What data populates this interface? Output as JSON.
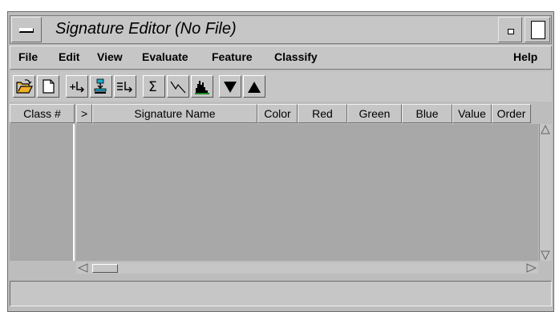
{
  "window": {
    "title": "Signature Editor (No File)"
  },
  "menubar": {
    "items": [
      {
        "label": "File"
      },
      {
        "label": "Edit"
      },
      {
        "label": "View"
      },
      {
        "label": "Evaluate"
      },
      {
        "label": "Feature"
      },
      {
        "label": "Classify"
      },
      {
        "label": "Help"
      }
    ]
  },
  "toolbar": {
    "buttons": [
      {
        "icon": "open-folder-icon"
      },
      {
        "icon": "new-file-icon"
      },
      {
        "icon": "add-signature-icon"
      },
      {
        "icon": "replace-signature-icon"
      },
      {
        "icon": "merge-signatures-icon"
      },
      {
        "icon": "statistics-sigma-icon"
      },
      {
        "icon": "mean-plot-icon"
      },
      {
        "icon": "histogram-icon"
      },
      {
        "icon": "move-down-icon"
      },
      {
        "icon": "move-up-icon"
      }
    ]
  },
  "table": {
    "columns": [
      "Class #",
      ">",
      "Signature Name",
      "Color",
      "Red",
      "Green",
      "Blue",
      "Value",
      "Order"
    ],
    "rows": []
  },
  "status": {
    "text": ""
  },
  "colors": {
    "panel": "#c6c6c6",
    "table_bg": "#a8a8a8"
  }
}
